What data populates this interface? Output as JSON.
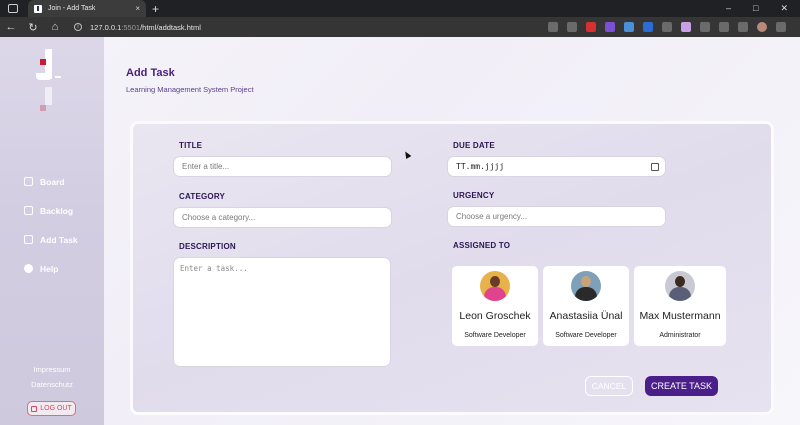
{
  "browser": {
    "tab_title": "Join - Add Task",
    "tab_close": "×",
    "new_tab": "+",
    "url_host": "127.0.0.1",
    "url_port": ":5501",
    "url_path": "/html/addtask.html",
    "win_min": "–",
    "win_max": "□",
    "win_close": "✕"
  },
  "sidebar": {
    "nav": [
      {
        "label": "Board",
        "icon": "board-icon"
      },
      {
        "label": "Backlog",
        "icon": "backlog-icon"
      },
      {
        "label": "Add Task",
        "icon": "add-task-icon"
      },
      {
        "label": "Help",
        "icon": "help-icon"
      }
    ],
    "imprint": "Impressum",
    "privacy": "Datenschutz",
    "logout": "LOG OUT"
  },
  "header": {
    "title": "Add Task",
    "subtitle": "Learning Management System Project"
  },
  "form": {
    "title_label": "TITLE",
    "title_placeholder": "Enter a title...",
    "category_label": "CATEGORY",
    "category_placeholder": "Choose a category...",
    "description_label": "DESCRIPTION",
    "description_placeholder": "Enter a task...",
    "due_label": "DUE DATE",
    "due_placeholder": "TT.mm.jjjj",
    "urgency_label": "URGENCY",
    "urgency_placeholder": "Choose a urgency...",
    "assigned_label": "ASSIGNED TO"
  },
  "users": [
    {
      "name": "Leon Groschek",
      "role": "Software Developer",
      "colors": {
        "bg": "#e8b24a",
        "head": "#6a3b2a",
        "body": "#e0448f"
      }
    },
    {
      "name": "Anastasiia Ünal",
      "role": "Software Developer",
      "colors": {
        "bg": "#7ea0b8",
        "head": "#c9a27a",
        "body": "#2a2a2a"
      }
    },
    {
      "name": "Max Mustermann",
      "role": "Administrator",
      "colors": {
        "bg": "#c9c9d4",
        "head": "#3b2a22",
        "body": "#5a5f78"
      }
    }
  ],
  "actions": {
    "cancel": "CANCEL",
    "create": "CREATE TASK"
  },
  "colors": {
    "accent": "#4b1f8a",
    "logo_red": "#c81a35",
    "logout_red": "#d24a65"
  }
}
